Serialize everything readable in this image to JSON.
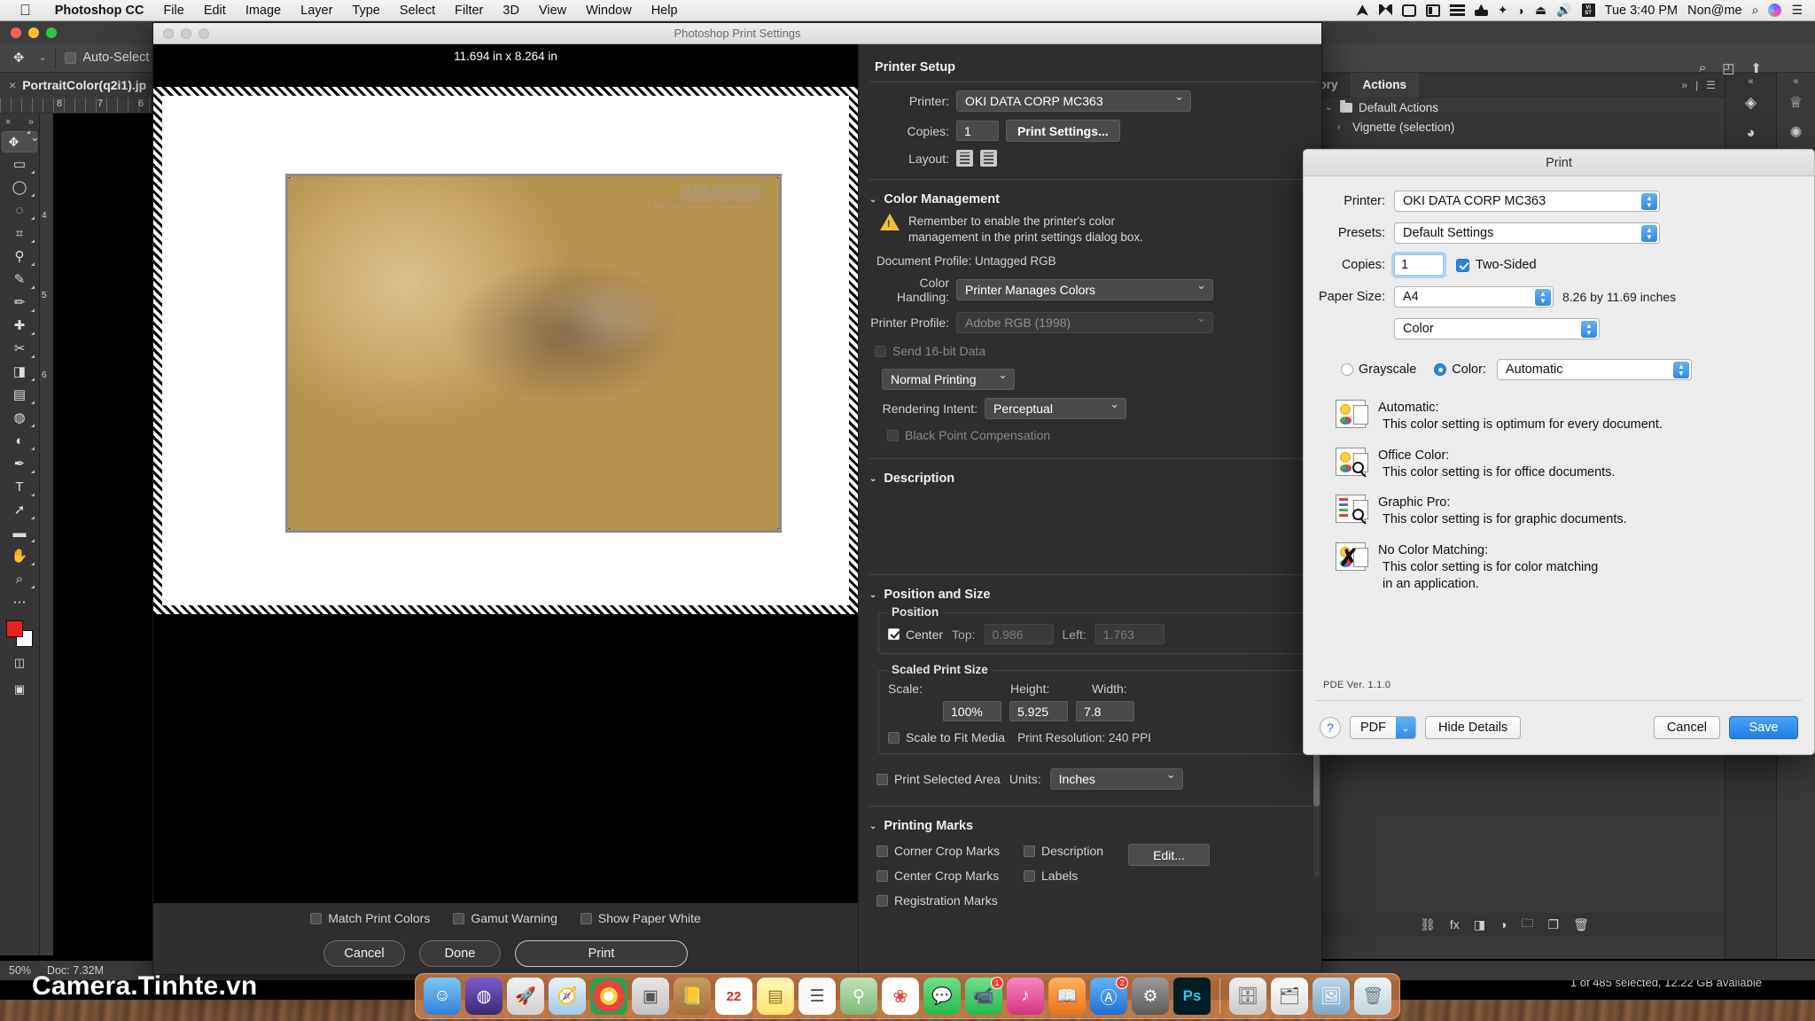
{
  "menubar": {
    "apple_icon": "apple-icon",
    "items": [
      {
        "label": "Photoshop CC",
        "bold": true
      },
      {
        "label": "File",
        "bold": false
      },
      {
        "label": "Edit",
        "bold": false
      },
      {
        "label": "Image",
        "bold": false
      },
      {
        "label": "Layer",
        "bold": false
      },
      {
        "label": "Type",
        "bold": false
      },
      {
        "label": "Select",
        "bold": false
      },
      {
        "label": "Filter",
        "bold": false
      },
      {
        "label": "3D",
        "bold": false
      },
      {
        "label": "View",
        "bold": false
      },
      {
        "label": "Window",
        "bold": false
      },
      {
        "label": "Help",
        "bold": false
      }
    ],
    "status": {
      "time": "Tue 3:40 PM",
      "user": "Non@me",
      "bluetooth_icon": "bluetooth-icon",
      "wifi_icon": "wifi-icon",
      "eject_icon": "eject-icon",
      "volume_icon": "volume-icon",
      "vst_icon": "vst-icon",
      "search_icon": "spotlight-search-icon",
      "siri_icon": "siri-icon",
      "notification_icon": "notification-center-icon"
    }
  },
  "photoshop": {
    "options_bar": {
      "tool_icon": "move-tool-icon",
      "auto_select_label": "Auto-Select",
      "auto_select_checked": false
    },
    "document_tab": {
      "name": "PortraitColor(q2i1).jp",
      "close_icon": "close-icon"
    },
    "ruler_numbers": [
      "8",
      "7",
      "6"
    ],
    "vertical_ruler_numbers": [
      "4",
      "5",
      "6"
    ],
    "status_bar": {
      "zoom": "50%",
      "doc_size": "Doc: 7.32M"
    },
    "tools": [
      {
        "name": "move-tool",
        "glyph": "✥",
        "selected": true
      },
      {
        "name": "marquee-tool",
        "glyph": "▭",
        "selected": false
      },
      {
        "name": "lasso-tool",
        "glyph": "♮",
        "selected": false
      },
      {
        "name": "crop-tool",
        "glyph": "⌗",
        "selected": false
      },
      {
        "name": "eyedropper-tool",
        "glyph": "⚲",
        "selected": false
      },
      {
        "name": "healing-brush-tool",
        "glyph": "✎",
        "selected": false
      },
      {
        "name": "brush-tool",
        "glyph": "✏",
        "selected": false
      },
      {
        "name": "clone-stamp-tool",
        "glyph": "❏",
        "selected": false
      },
      {
        "name": "history-brush-tool",
        "glyph": "✂",
        "selected": false
      },
      {
        "name": "eraser-tool",
        "glyph": "◨",
        "selected": false
      },
      {
        "name": "gradient-tool",
        "glyph": "▧",
        "selected": false
      },
      {
        "name": "blur-tool",
        "glyph": "💧",
        "selected": false
      },
      {
        "name": "dodge-tool",
        "glyph": "◐",
        "selected": false
      },
      {
        "name": "pen-tool",
        "glyph": "✒",
        "selected": false
      },
      {
        "name": "type-tool",
        "glyph": "T",
        "selected": false
      },
      {
        "name": "path-selection-tool",
        "glyph": "➚",
        "selected": false
      },
      {
        "name": "rectangle-tool",
        "glyph": "▬",
        "selected": false
      },
      {
        "name": "hand-tool",
        "glyph": "✋",
        "selected": false
      },
      {
        "name": "zoom-tool",
        "glyph": "🔍",
        "selected": false
      },
      {
        "name": "more-tools",
        "glyph": "⋯",
        "selected": false
      }
    ],
    "colors": {
      "foreground": "#e8221e",
      "background": "#ffffff"
    }
  },
  "panels": {
    "tabs": [
      {
        "label": "History",
        "active": false
      },
      {
        "label": "Actions",
        "active": true
      }
    ],
    "menu_icon": "panel-menu-icon",
    "expand_icon": "panel-expand-icon",
    "actions": [
      {
        "label": "Default Actions",
        "checked": true,
        "expanded": true
      },
      {
        "label": "Vignette (selection)",
        "checked": true,
        "expanded": false
      }
    ],
    "footer_icons": [
      "link-icon",
      "fx-icon",
      "mask-icon",
      "adjustment-icon",
      "group-icon",
      "new-layer-icon",
      "delete-icon"
    ],
    "side_icons": [
      "layers-icon",
      "color-wheel-icon",
      "brush-icon",
      "settings-icon"
    ]
  },
  "print_settings": {
    "window_title": "Photoshop Print Settings",
    "preview": {
      "dimensions": "11.694 in x 8.264 in",
      "photo_watermark": "datacolor",
      "photo_watermark_sub": "© 2007-2015 Datacolor. www.datacolor.com"
    },
    "preview_checks": [
      {
        "label": "Match Print Colors",
        "checked": false
      },
      {
        "label": "Gamut Warning",
        "checked": false
      },
      {
        "label": "Show Paper White",
        "checked": false
      }
    ],
    "buttons": [
      {
        "label": "Cancel",
        "primary": false
      },
      {
        "label": "Done",
        "primary": false
      },
      {
        "label": "Print",
        "primary": true
      }
    ],
    "printer_setup": {
      "title": "Printer Setup",
      "printer_label": "Printer:",
      "printer_value": "OKI DATA CORP MC363",
      "copies_label": "Copies:",
      "copies_value": "1",
      "print_settings_button": "Print Settings...",
      "layout_label": "Layout:",
      "layout_icons": [
        "portrait-layout-icon",
        "landscape-layout-icon"
      ]
    },
    "color_management": {
      "title": "Color Management",
      "warning_icon": "warning-icon",
      "warning_text": "Remember to enable the printer's color management in the print settings dialog box.",
      "document_profile": "Document Profile: Untagged RGB",
      "color_handling_label": "Color Handling:",
      "color_handling_value": "Printer Manages Colors",
      "printer_profile_label": "Printer Profile:",
      "printer_profile_value": "Adobe RGB (1998)",
      "send_16bit_label": "Send 16-bit Data",
      "send_16bit_checked": false,
      "normal_printing_value": "Normal Printing",
      "rendering_intent_label": "Rendering Intent:",
      "rendering_intent_value": "Perceptual",
      "black_point_label": "Black Point Compensation",
      "black_point_checked": false
    },
    "description": {
      "title": "Description",
      "body": ""
    },
    "position_and_size": {
      "title": "Position and Size",
      "position_group": "Position",
      "center_label": "Center",
      "center_checked": true,
      "top_label": "Top:",
      "top_value": "0.986",
      "left_label": "Left:",
      "left_value": "1.763",
      "scaled_group": "Scaled Print Size",
      "scale_label": "Scale:",
      "scale_value": "100%",
      "height_label": "Height:",
      "height_value": "5.925",
      "width_label": "Width:",
      "width_value": "7.8",
      "scale_to_fit_label": "Scale to Fit Media",
      "scale_to_fit_checked": false,
      "print_resolution": "Print Resolution: 240 PPI",
      "print_selected_area_label": "Print Selected Area",
      "print_selected_area_checked": false,
      "units_label": "Units:",
      "units_value": "Inches"
    },
    "printing_marks": {
      "title": "Printing Marks",
      "corner_crop_label": "Corner Crop Marks",
      "corner_crop_checked": false,
      "center_crop_label": "Center Crop Marks",
      "center_crop_checked": false,
      "registration_label": "Registration Marks",
      "registration_checked": false,
      "description_label": "Description",
      "description_checked": false,
      "labels_label": "Labels",
      "labels_checked": false,
      "edit_button": "Edit..."
    }
  },
  "mac_print_dialog": {
    "title": "Print",
    "printer_label": "Printer:",
    "printer_value": "OKI DATA CORP MC363",
    "presets_label": "Presets:",
    "presets_value": "Default Settings",
    "copies_label": "Copies:",
    "copies_value": "1",
    "two_sided_label": "Two-Sided",
    "two_sided_checked": true,
    "paper_size_label": "Paper Size:",
    "paper_size_value": "A4",
    "paper_size_note": "8.26 by 11.69 inches",
    "pane_value": "Color",
    "grayscale_label": "Grayscale",
    "grayscale_selected": false,
    "color_label": "Color:",
    "color_selected": true,
    "color_value": "Automatic",
    "color_settings": [
      {
        "icon": "automatic-color-icon",
        "title": "Automatic:",
        "desc": "This color setting is optimum for every document."
      },
      {
        "icon": "office-color-icon",
        "title": "Office Color:",
        "desc": "This color setting is for office documents."
      },
      {
        "icon": "graphic-pro-icon",
        "title": "Graphic Pro:",
        "desc": "This color setting is for graphic documents."
      },
      {
        "icon": "no-color-matching-icon",
        "title": "No Color Matching:",
        "desc": "This color setting is for color matching in an application."
      }
    ],
    "pde_version": "PDE Ver.  1.1.0",
    "help_icon": "help-icon",
    "pdf_button": "PDF",
    "hide_details_button": "Hide Details",
    "cancel_button": "Cancel",
    "save_button": "Save"
  },
  "desktop": {
    "site_watermark": "Camera.Tinhte.vn",
    "finder_status": "1 of 485 selected, 12.22 GB available",
    "dock_items": [
      {
        "name": "finder",
        "glyph": "🙂",
        "color": "#2f7fe0",
        "badge": ""
      },
      {
        "name": "siri",
        "glyph": "◍",
        "color": "#5a3fa8",
        "badge": ""
      },
      {
        "name": "launchpad",
        "glyph": "🚀",
        "color": "#c8c8c8",
        "badge": ""
      },
      {
        "name": "safari",
        "glyph": "🧭",
        "color": "#2f9fe0",
        "badge": ""
      },
      {
        "name": "chrome",
        "glyph": "◉",
        "color": "#e8453c",
        "badge": ""
      },
      {
        "name": "photos-booth",
        "glyph": "📷",
        "color": "#d8d8d8",
        "badge": ""
      },
      {
        "name": "contacts",
        "glyph": "📒",
        "color": "#b2844a",
        "badge": ""
      },
      {
        "name": "calendar",
        "glyph": "22",
        "color": "#ffffff",
        "badge": ""
      },
      {
        "name": "notes",
        "glyph": "▤",
        "color": "#ffe56b",
        "badge": ""
      },
      {
        "name": "reminders",
        "glyph": "☰",
        "color": "#f2f2f2",
        "badge": ""
      },
      {
        "name": "maps",
        "glyph": "🗺",
        "color": "#8ec98e",
        "badge": ""
      },
      {
        "name": "photos",
        "glyph": "❀",
        "color": "#ffffff",
        "badge": ""
      },
      {
        "name": "messages",
        "glyph": "💬",
        "color": "#3fc45a",
        "badge": ""
      },
      {
        "name": "facetime",
        "glyph": "📹",
        "color": "#3fc45a",
        "badge": "1"
      },
      {
        "name": "itunes",
        "glyph": "♪",
        "color": "#e8478a",
        "badge": ""
      },
      {
        "name": "ibooks",
        "glyph": "📖",
        "color": "#f08a2a",
        "badge": ""
      },
      {
        "name": "app-store",
        "glyph": "Ⓐ",
        "color": "#2f8ae4",
        "badge": "2"
      },
      {
        "name": "system-preferences",
        "glyph": "⚙",
        "color": "#7a7a7a",
        "badge": ""
      },
      {
        "name": "photoshop",
        "glyph": "Ps",
        "color": "#001e26",
        "badge": ""
      },
      {
        "name": "downloads-stack",
        "glyph": "🗄",
        "color": "#cfcfcf",
        "badge": ""
      },
      {
        "name": "documents-stack",
        "glyph": "🗂",
        "color": "#e6e6e6",
        "badge": ""
      },
      {
        "name": "pictures-stack",
        "glyph": "🖼",
        "color": "#9ac0de",
        "badge": ""
      },
      {
        "name": "trash",
        "glyph": "🗑",
        "color": "#d8e4ea",
        "badge": ""
      }
    ]
  }
}
